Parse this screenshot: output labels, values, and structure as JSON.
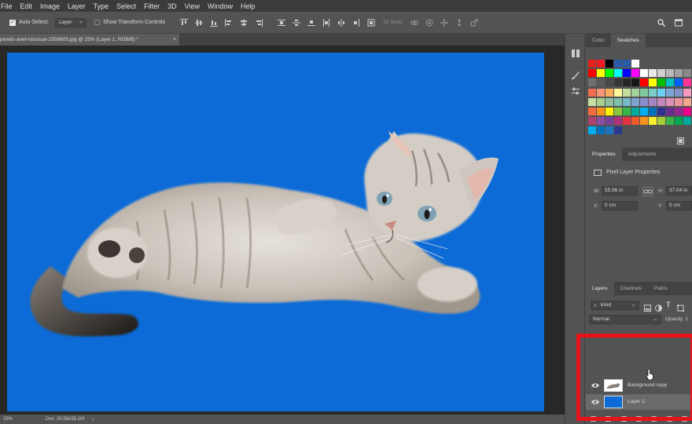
{
  "menu": [
    "File",
    "Edit",
    "Image",
    "Layer",
    "Type",
    "Select",
    "Filter",
    "3D",
    "View",
    "Window",
    "Help"
  ],
  "options": {
    "auto_select_label": "Auto-Select:",
    "auto_select_checked": true,
    "target_value": "Layer",
    "transform_controls_label": "Show Transform Controls",
    "mode_3d_label": "3D Mode:"
  },
  "document": {
    "tab_title": "pexels-anel-rossouw-2558605.jpg @ 25% (Layer 1, RGB/8) *",
    "close_glyph": "×",
    "zoom": "25%",
    "doc_size": "Doc: 30.5M/35.1M",
    "status_arrow": "›"
  },
  "panels": {
    "color_tabs": [
      "Color",
      "Swatches"
    ],
    "active_color_tab": "Swatches",
    "props_tabs": [
      "Properties",
      "Adjustments"
    ],
    "props_title": "Pixel Layer Properties",
    "props": {
      "w_label": "W:",
      "w_value": "55.56 in",
      "h_label": "H:",
      "h_value": "37.04 in",
      "x_label": "X:",
      "x_value": "0 cm",
      "y_label": "Y:",
      "y_value": "0 cm"
    },
    "layers_tabs": [
      "Layers",
      "Channels",
      "Paths"
    ],
    "kind_label": "Kind",
    "blend_mode": "Normal",
    "opacity_label": "Opacity: 1",
    "layers": [
      {
        "name": "Background copy",
        "selected": false,
        "thumb": "cat"
      },
      {
        "name": "Layer 1",
        "selected": true,
        "thumb": "#0c6bd6"
      }
    ]
  },
  "swatch_rows": [
    [
      "#e3231b",
      "#ee1c24",
      "#000000",
      "#2a5aa8",
      "#2a5aa8",
      "#ffffff"
    ],
    [
      "#ff0000",
      "#ffff00",
      "#00ff00",
      "#00ffff",
      "#0000ff",
      "#ff00ff",
      "#ffffff",
      "#e8e8e8",
      "#d0d0d0",
      "#b8b8b8",
      "#a0a0a0",
      "#888888"
    ],
    [
      "#707070",
      "#5a5a5a",
      "#484848",
      "#363636",
      "#262626",
      "#181818",
      "#ff0000",
      "#ffff00",
      "#00c000",
      "#00c0c0",
      "#0060ff",
      "#ff3399"
    ],
    [
      "#f26c4f",
      "#f7977a",
      "#fbaf5d",
      "#fff79a",
      "#c4df9b",
      "#a3d39c",
      "#82ca9d",
      "#7bcdc8",
      "#6ecff6",
      "#7ea7d8",
      "#8493ca",
      "#f49ac1"
    ],
    [
      "#c6e0a0",
      "#a8d08d",
      "#8fc1a0",
      "#7dbeae",
      "#78b8c8",
      "#7fa2cf",
      "#8b8ccb",
      "#a585c2",
      "#c287bd",
      "#de8fb8",
      "#e995a0",
      "#f4a68e"
    ],
    [
      "#f26b3a",
      "#f7941d",
      "#fff200",
      "#8dc63f",
      "#39b54a",
      "#00a99d",
      "#00aeef",
      "#0072bc",
      "#2e3192",
      "#662d91",
      "#92278f",
      "#ec008c"
    ],
    [
      "#b0416f",
      "#8b4ea0",
      "#7a3f99",
      "#b0307e",
      "#e6333f",
      "#f05a28",
      "#f7921e",
      "#f9ed32",
      "#a6ce39",
      "#39b54a",
      "#00a651",
      "#00a99d"
    ],
    [
      "#00aeef",
      "#0072bc",
      "#1b75bc",
      "#2b3990"
    ]
  ],
  "colors": {
    "canvas_blue": "#0c6bd6",
    "highlight_red": "#e8131a"
  }
}
